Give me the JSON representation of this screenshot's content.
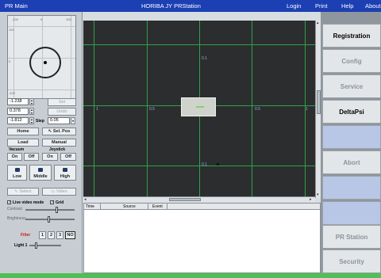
{
  "titlebar": {
    "app_name": "PR Main",
    "title": "HORIBA JY PRStation",
    "menu": [
      "Login",
      "Print",
      "Help",
      "About"
    ]
  },
  "minimap": {
    "ticks_top": [
      "-100",
      "0",
      "100"
    ],
    "ticks_left": [
      "100",
      "0",
      "-100"
    ]
  },
  "position": {
    "x": "-1.238",
    "y": "0.378",
    "z": "-1.812",
    "step_label": "Step",
    "step_value": "0.05",
    "set_label": "Set",
    "undo_label": "Undo",
    "home_label": "Home",
    "sel_pos_label": "Sel. Pos",
    "load_label": "Load",
    "manual_label": "Manual"
  },
  "vacuum": {
    "label": "Vacuum",
    "on": "On",
    "off": "Off"
  },
  "joystick": {
    "label": "Joystick",
    "on": "On",
    "off": "Off"
  },
  "objectives": [
    "Low",
    "Middle",
    "High"
  ],
  "select_label": "Select",
  "video_label": "Video",
  "live_video": {
    "label": "Live video mode",
    "checked": "✓"
  },
  "grid": {
    "label": "Grid",
    "checked": "✓"
  },
  "contrast_label": "Contrast",
  "brightness_label": "Brightness",
  "filter": {
    "label": "Filter",
    "options": [
      "1",
      "2",
      "3",
      "NO"
    ]
  },
  "light_label": "Light 1",
  "viewport": {
    "labels": [
      {
        "text": "0.1"
      },
      {
        "text": "1"
      },
      {
        "text": "0.5"
      },
      {
        "text": "0.5"
      },
      {
        "text": "1"
      },
      {
        "text": "0.1"
      }
    ]
  },
  "log": {
    "columns": [
      "Time",
      "Source",
      "Event"
    ]
  },
  "right_menu": [
    {
      "label": "Registration",
      "state": "active"
    },
    {
      "label": "Config",
      "state": "disabled"
    },
    {
      "label": "Service",
      "state": "disabled"
    },
    {
      "label": "DeltaPsi",
      "state": "active"
    },
    {
      "label": "",
      "state": "blank"
    },
    {
      "label": "Abort",
      "state": "disabled"
    },
    {
      "label": "",
      "state": "blank"
    },
    {
      "label": "",
      "state": "blank"
    },
    {
      "label": "PR Station",
      "state": "disabled"
    },
    {
      "label": "Security",
      "state": "disabled"
    }
  ],
  "statusbar": {
    "text": ""
  },
  "colors": {
    "titlebar": "#1c3fb4",
    "grid": "#2ea34a",
    "status": "#4fbf56"
  }
}
